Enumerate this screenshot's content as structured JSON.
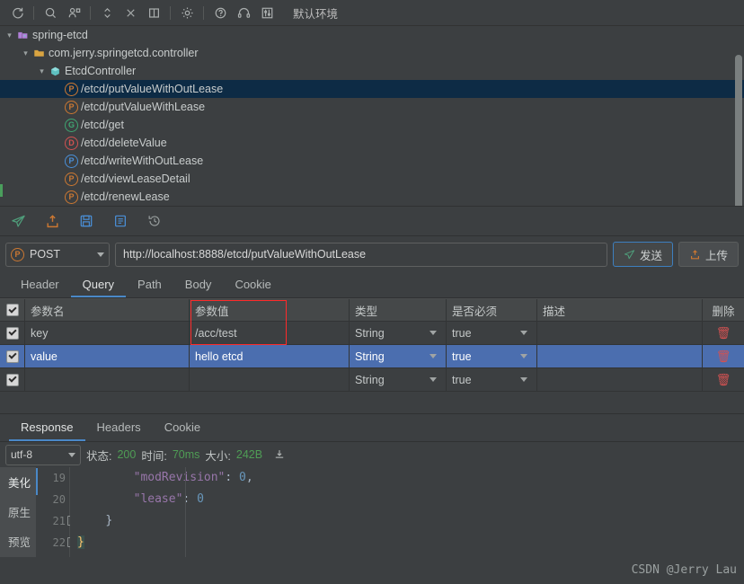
{
  "toolbar": {
    "icons": [
      {
        "name": "refresh-icon",
        "label": "refresh"
      },
      {
        "name": "search-icon",
        "label": "search"
      },
      {
        "name": "add-person-icon",
        "label": "add"
      },
      {
        "name": "expand-collapse-icon",
        "label": "expand"
      },
      {
        "name": "close-icon",
        "label": "close"
      },
      {
        "name": "split-panel-icon",
        "label": "split"
      },
      {
        "name": "gear-icon",
        "label": "settings"
      },
      {
        "name": "help-icon",
        "label": "help"
      },
      {
        "name": "headphones-icon",
        "label": "support"
      },
      {
        "name": "sliders-icon",
        "label": "tuning"
      }
    ],
    "environment": "默认环境"
  },
  "tree": {
    "nodes": [
      {
        "label": "spring-etcd",
        "icon": "project-folder-icon",
        "indent": 0,
        "arrow": "▾",
        "selected": false,
        "badge": ""
      },
      {
        "label": "com.jerry.springetcd.controller",
        "icon": "package-folder-icon",
        "indent": 1,
        "arrow": "▾",
        "selected": false,
        "badge": ""
      },
      {
        "label": "EtcdController",
        "icon": "class-icon",
        "indent": 2,
        "arrow": "▾",
        "selected": false,
        "badge": ""
      },
      {
        "label": "/etcd/putValueWithOutLease",
        "icon": "",
        "indent": 3,
        "arrow": "",
        "selected": true,
        "badge": "P",
        "badgeType": "post"
      },
      {
        "label": "/etcd/putValueWithLease",
        "icon": "",
        "indent": 3,
        "arrow": "",
        "selected": false,
        "badge": "P",
        "badgeType": "post"
      },
      {
        "label": "/etcd/get",
        "icon": "",
        "indent": 3,
        "arrow": "",
        "selected": false,
        "badge": "G",
        "badgeType": "get"
      },
      {
        "label": "/etcd/deleteValue",
        "icon": "",
        "indent": 3,
        "arrow": "",
        "selected": false,
        "badge": "D",
        "badgeType": "delete"
      },
      {
        "label": "/etcd/writeWithOutLease",
        "icon": "",
        "indent": 3,
        "arrow": "",
        "selected": false,
        "badge": "P",
        "badgeType": "put"
      },
      {
        "label": "/etcd/viewLeaseDetail",
        "icon": "",
        "indent": 3,
        "arrow": "",
        "selected": false,
        "badge": "P",
        "badgeType": "post"
      },
      {
        "label": "/etcd/renewLease",
        "icon": "",
        "indent": 3,
        "arrow": "",
        "selected": false,
        "badge": "P",
        "badgeType": "post"
      }
    ]
  },
  "actions": {
    "icons": [
      {
        "name": "send-plane-icon",
        "color": "#4f9d7a"
      },
      {
        "name": "upload-icon",
        "color": "#cc7832"
      },
      {
        "name": "save-icon",
        "color": "#4a90d9"
      },
      {
        "name": "document-icon",
        "color": "#4a90d9"
      },
      {
        "name": "history-icon",
        "color": "#9aa0a0"
      }
    ]
  },
  "request": {
    "method": "POST",
    "url": "http://localhost:8888/etcd/putValueWithOutLease",
    "send_label": "发送",
    "upload_label": "上传",
    "tabs": [
      {
        "label": "Header",
        "active": false
      },
      {
        "label": "Query",
        "active": true
      },
      {
        "label": "Path",
        "active": false
      },
      {
        "label": "Body",
        "active": false
      },
      {
        "label": "Cookie",
        "active": false
      }
    ]
  },
  "params_table": {
    "headers": [
      "参数名",
      "参数值",
      "类型",
      "是否必须",
      "描述",
      "删除"
    ],
    "rows": [
      {
        "checked": true,
        "name": "key",
        "value": "/acc/test",
        "type": "String",
        "required": "true",
        "desc": "",
        "selected": false
      },
      {
        "checked": true,
        "name": "value",
        "value": "hello etcd",
        "type": "String",
        "required": "true",
        "desc": "",
        "selected": true
      },
      {
        "checked": true,
        "name": "",
        "value": "",
        "type": "String",
        "required": "true",
        "desc": "",
        "selected": false
      }
    ]
  },
  "response": {
    "tabs": [
      {
        "label": "Response",
        "active": true
      },
      {
        "label": "Headers",
        "active": false
      },
      {
        "label": "Cookie",
        "active": false
      }
    ],
    "encoding": "utf-8",
    "status_label": "状态:",
    "status_value": "200",
    "time_label": "时间:",
    "time_value": "70ms",
    "size_label": "大小:",
    "size_value": "242B",
    "download_icon": "download-icon",
    "side_tabs": [
      {
        "label": "美化",
        "active": true
      },
      {
        "label": "原生",
        "active": false
      },
      {
        "label": "预览",
        "active": false
      }
    ],
    "code_lines": [
      {
        "num": "19",
        "fold": false,
        "key": "\"modRevision\"",
        "sep": ": ",
        "val": "0",
        "tail": ",",
        "indent": 4,
        "brace": ""
      },
      {
        "num": "20",
        "fold": false,
        "key": "\"lease\"",
        "sep": ": ",
        "val": "0",
        "tail": "",
        "indent": 4,
        "brace": ""
      },
      {
        "num": "21",
        "fold": true,
        "key": "",
        "sep": "",
        "val": "",
        "tail": "",
        "indent": 2,
        "brace": "}"
      },
      {
        "num": "22",
        "fold": true,
        "key": "",
        "sep": "",
        "val": "",
        "tail": "",
        "indent": 0,
        "brace": "}",
        "highlight": true
      }
    ]
  },
  "watermark": "CSDN @Jerry Lau",
  "colors": {
    "background": "#3c3f41",
    "selection_blue": "#4b6eaf",
    "tree_selection": "#0d2b45",
    "accent_blue": "#4a88c7",
    "post_orange": "#cc7832",
    "get_green": "#3fa672",
    "delete_red": "#d25252",
    "status_green": "#4f9d55",
    "annotation_red": "#ff2a2a"
  }
}
